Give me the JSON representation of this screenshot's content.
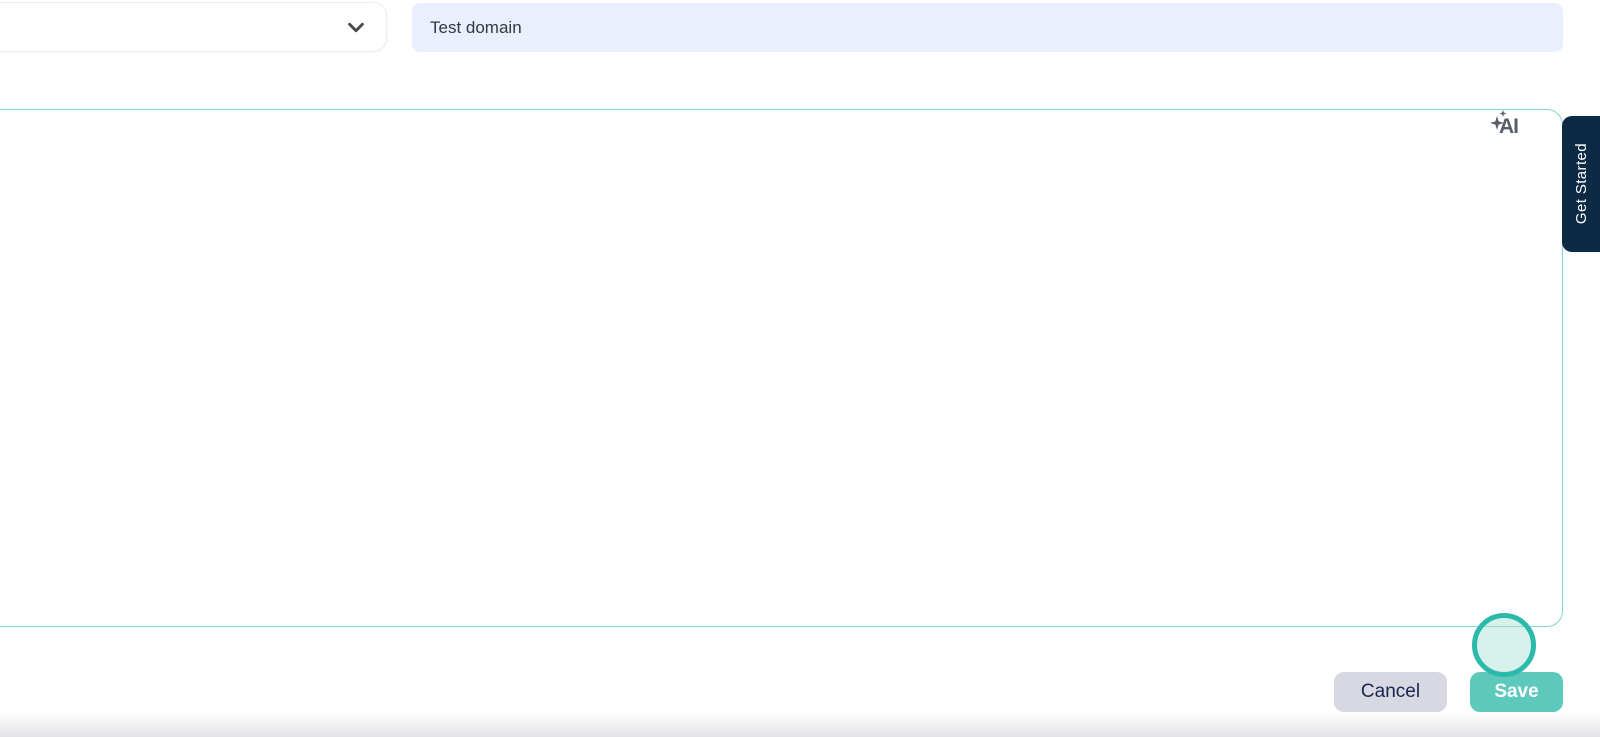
{
  "toolbar": {
    "category_dropdown": {
      "selected_value": "",
      "icon": "chevron-down"
    },
    "domain_input": {
      "value": "Test domain",
      "placeholder": ""
    }
  },
  "editor": {
    "content": "",
    "ai_button_label": "AI"
  },
  "side_tab": {
    "label": "Get Started"
  },
  "footer": {
    "cancel_label": "Cancel",
    "save_label": "Save"
  },
  "annotation": {
    "type": "click-highlight-circle",
    "target": "save-button"
  },
  "colors": {
    "accent_teal": "#5cc9bc",
    "accent_teal_dark": "#2bb9a9",
    "editor_border": "#85d4cb",
    "input_bg": "#e9effc",
    "tab_bg": "#0d2a45",
    "cancel_bg": "#d8d8e2",
    "navy_text": "#17274e"
  }
}
